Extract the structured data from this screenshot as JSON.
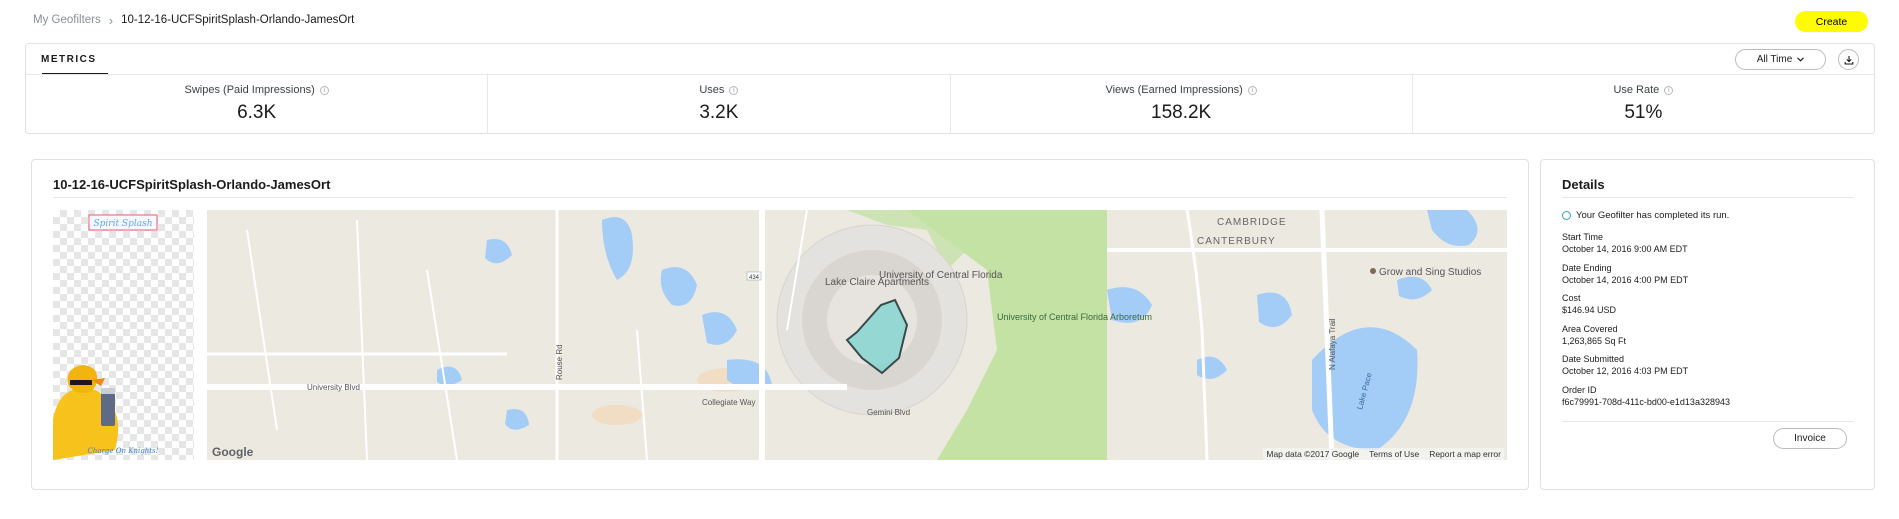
{
  "breadcrumb": {
    "parent": "My Geofilters",
    "current": "10-12-16-UCFSpiritSplash-Orlando-JamesOrt"
  },
  "header": {
    "create_label": "Create",
    "create_color": "#fffc00"
  },
  "metrics": {
    "tab_label": "METRICS",
    "range_label": "All Time",
    "download_icon": "download-icon",
    "stats": [
      {
        "label": "Swipes (Paid Impressions)",
        "value": "6.3K"
      },
      {
        "label": "Uses",
        "value": "3.2K"
      },
      {
        "label": "Views (Earned Impressions)",
        "value": "158.2K"
      },
      {
        "label": "Use Rate",
        "value": "51%"
      }
    ]
  },
  "geofilter": {
    "title": "10-12-16-UCFSpiritSplash-Orlando-JamesOrt",
    "filter_text_top": "Spirit Splash",
    "filter_text_bottom": "Charge On Knights!"
  },
  "map": {
    "labels": {
      "lake_claire": "Lake Claire Apartments",
      "ucf": "University of Central Florida",
      "arboretum": "University of Central Florida Arboretum",
      "cambridge": "CAMBRIDGE",
      "canterbury": "CANTERBURY",
      "studios": "Grow and Sing Studios",
      "university_blvd": "University Blvd",
      "collegiate_way": "Collegiate Way",
      "lake_pace": "Lake Pace",
      "gemini_blvd": "Gemini Blvd",
      "rouse_rd": "Rouse Rd",
      "alafaya": "N Alafaya Trail",
      "route": "434"
    },
    "attribution": {
      "data": "Map data ©2017 Google",
      "terms": "Terms of Use",
      "report": "Report a map error"
    },
    "logo": "Google",
    "geofence_color": "#7fd3cf"
  },
  "details": {
    "title": "Details",
    "status": "Your Geofilter has completed its run.",
    "status_color": "#2ea0c8",
    "items": [
      {
        "key": "Start Time",
        "value": "October 14, 2016 9:00 AM  EDT"
      },
      {
        "key": "Date Ending",
        "value": "October 14, 2016 4:00 PM  EDT"
      },
      {
        "key": "Cost",
        "value": "$146.94 USD"
      },
      {
        "key": "Area Covered",
        "value": "1,263,865 Sq Ft"
      },
      {
        "key": "Date Submitted",
        "value": "October 12, 2016 4:03 PM  EDT"
      },
      {
        "key": "Order ID",
        "value": "f6c79991-708d-411c-bd00-e1d13a328943"
      }
    ],
    "invoice_label": "Invoice"
  }
}
